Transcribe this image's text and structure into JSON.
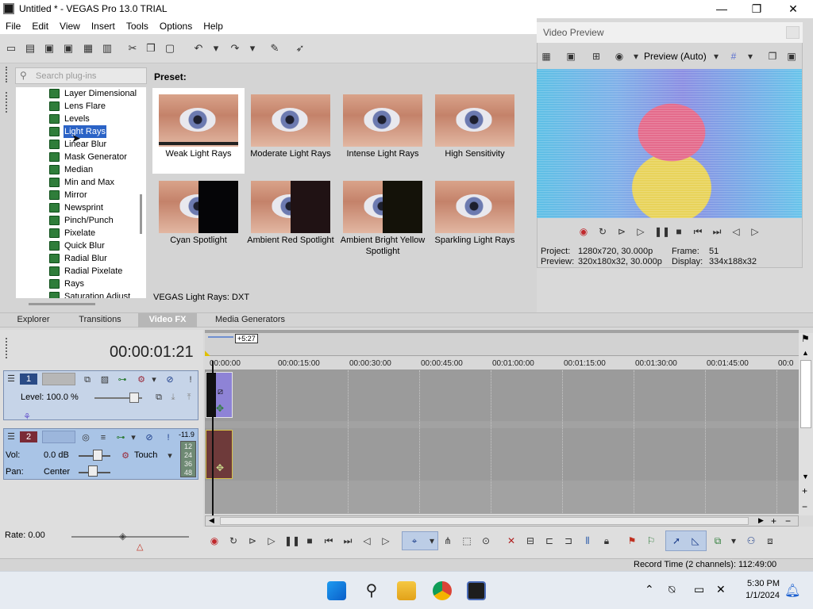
{
  "window": {
    "title": "Untitled * - VEGAS Pro 13.0 TRIAL",
    "minimize": "—",
    "maximize": "❐",
    "close": "✕"
  },
  "menu": [
    "File",
    "Edit",
    "View",
    "Insert",
    "Tools",
    "Options",
    "Help"
  ],
  "search": {
    "placeholder": "Search plug-ins"
  },
  "plugins": [
    "Layer Dimensional",
    "Lens Flare",
    "Levels",
    "Light Rays",
    "Linear Blur",
    "Mask Generator",
    "Median",
    "Min and Max",
    "Mirror",
    "Newsprint",
    "Pinch/Punch",
    "Pixelate",
    "Quick Blur",
    "Radial Blur",
    "Radial Pixelate",
    "Rays",
    "Saturation Adjust"
  ],
  "selected_plugin": "Light Rays",
  "preset_label": "Preset:",
  "presets": [
    {
      "name": "Weak Light Rays"
    },
    {
      "name": "Moderate Light Rays"
    },
    {
      "name": "Intense Light Rays"
    },
    {
      "name": "High Sensitivity"
    },
    {
      "name": "Cyan Spotlight"
    },
    {
      "name": "Ambient Red Spotlight"
    },
    {
      "name": "Ambient Bright Yellow Spotlight"
    },
    {
      "name": "Sparkling Light Rays"
    }
  ],
  "fx_name": "VEGAS Light Rays: DXT",
  "video_preview": {
    "title": "Video Preview",
    "quality": "Preview (Auto)",
    "project_label": "Project:",
    "project_value": "1280x720, 30.000p",
    "preview_label": "Preview:",
    "preview_value": "320x180x32, 30.000p",
    "frame_label": "Frame:",
    "frame_value": "51",
    "display_label": "Display:",
    "display_value": "334x188x32"
  },
  "tabs": [
    "Explorer",
    "Transitions",
    "Video FX",
    "Media Generators"
  ],
  "active_tab": "Video FX",
  "timeline": {
    "timecode": "00:00:01:21",
    "region_label": "+5:27",
    "ruler": [
      "00:00:00",
      "00:00:15:00",
      "00:00:30:00",
      "00:00:45:00",
      "00:01:00:00",
      "00:01:15:00",
      "00:01:30:00",
      "00:01:45:00",
      "00:0"
    ],
    "video_track": {
      "number": "1",
      "level": "Level: 100.0 %"
    },
    "audio_track": {
      "number": "2",
      "vol_label": "Vol:",
      "vol_value": "0.0 dB",
      "pan_label": "Pan:",
      "pan_value": "Center",
      "automation": "Touch",
      "meter_top": "-11.9",
      "meter_ticks": [
        "12",
        "24",
        "36",
        "48"
      ]
    }
  },
  "rate": "Rate: 0.00",
  "status": "Record Time (2 channels): 112:49:00",
  "clock": {
    "time": "5:30 PM",
    "date": "1/1/2024"
  },
  "colors": {
    "accent": "#2b63c6",
    "selected_tab": "#b7b7b7"
  }
}
